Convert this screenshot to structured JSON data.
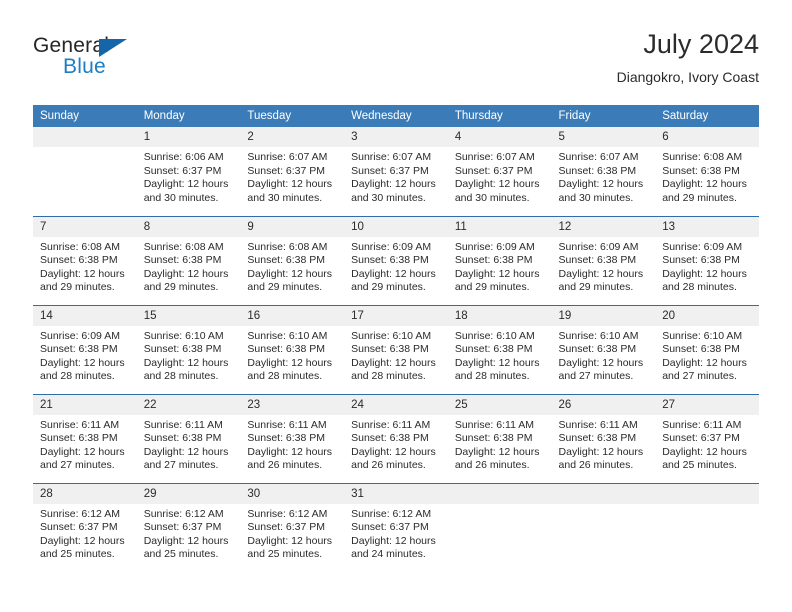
{
  "brand": {
    "word_one": "General",
    "word_two": "Blue",
    "accent_color": "#1d7ec4",
    "triangle_color": "#1565a8"
  },
  "header": {
    "title": "July 2024",
    "location": "Diangokro, Ivory Coast"
  },
  "theme": {
    "header_row_bg": "#3b7cb8",
    "header_row_text": "#ffffff",
    "daynum_bg": "#f0f0f0",
    "row_separator": "#2f6da8",
    "body_text": "#2b2b2b"
  },
  "weekday_headers": [
    "Sunday",
    "Monday",
    "Tuesday",
    "Wednesday",
    "Thursday",
    "Friday",
    "Saturday"
  ],
  "weeks": [
    [
      {
        "day": "",
        "sunrise": "",
        "sunset": "",
        "daylight_line1": "",
        "daylight_line2": ""
      },
      {
        "day": "1",
        "sunrise": "Sunrise: 6:06 AM",
        "sunset": "Sunset: 6:37 PM",
        "daylight_line1": "Daylight: 12 hours",
        "daylight_line2": "and 30 minutes."
      },
      {
        "day": "2",
        "sunrise": "Sunrise: 6:07 AM",
        "sunset": "Sunset: 6:37 PM",
        "daylight_line1": "Daylight: 12 hours",
        "daylight_line2": "and 30 minutes."
      },
      {
        "day": "3",
        "sunrise": "Sunrise: 6:07 AM",
        "sunset": "Sunset: 6:37 PM",
        "daylight_line1": "Daylight: 12 hours",
        "daylight_line2": "and 30 minutes."
      },
      {
        "day": "4",
        "sunrise": "Sunrise: 6:07 AM",
        "sunset": "Sunset: 6:37 PM",
        "daylight_line1": "Daylight: 12 hours",
        "daylight_line2": "and 30 minutes."
      },
      {
        "day": "5",
        "sunrise": "Sunrise: 6:07 AM",
        "sunset": "Sunset: 6:38 PM",
        "daylight_line1": "Daylight: 12 hours",
        "daylight_line2": "and 30 minutes."
      },
      {
        "day": "6",
        "sunrise": "Sunrise: 6:08 AM",
        "sunset": "Sunset: 6:38 PM",
        "daylight_line1": "Daylight: 12 hours",
        "daylight_line2": "and 29 minutes."
      }
    ],
    [
      {
        "day": "7",
        "sunrise": "Sunrise: 6:08 AM",
        "sunset": "Sunset: 6:38 PM",
        "daylight_line1": "Daylight: 12 hours",
        "daylight_line2": "and 29 minutes."
      },
      {
        "day": "8",
        "sunrise": "Sunrise: 6:08 AM",
        "sunset": "Sunset: 6:38 PM",
        "daylight_line1": "Daylight: 12 hours",
        "daylight_line2": "and 29 minutes."
      },
      {
        "day": "9",
        "sunrise": "Sunrise: 6:08 AM",
        "sunset": "Sunset: 6:38 PM",
        "daylight_line1": "Daylight: 12 hours",
        "daylight_line2": "and 29 minutes."
      },
      {
        "day": "10",
        "sunrise": "Sunrise: 6:09 AM",
        "sunset": "Sunset: 6:38 PM",
        "daylight_line1": "Daylight: 12 hours",
        "daylight_line2": "and 29 minutes."
      },
      {
        "day": "11",
        "sunrise": "Sunrise: 6:09 AM",
        "sunset": "Sunset: 6:38 PM",
        "daylight_line1": "Daylight: 12 hours",
        "daylight_line2": "and 29 minutes."
      },
      {
        "day": "12",
        "sunrise": "Sunrise: 6:09 AM",
        "sunset": "Sunset: 6:38 PM",
        "daylight_line1": "Daylight: 12 hours",
        "daylight_line2": "and 29 minutes."
      },
      {
        "day": "13",
        "sunrise": "Sunrise: 6:09 AM",
        "sunset": "Sunset: 6:38 PM",
        "daylight_line1": "Daylight: 12 hours",
        "daylight_line2": "and 28 minutes."
      }
    ],
    [
      {
        "day": "14",
        "sunrise": "Sunrise: 6:09 AM",
        "sunset": "Sunset: 6:38 PM",
        "daylight_line1": "Daylight: 12 hours",
        "daylight_line2": "and 28 minutes."
      },
      {
        "day": "15",
        "sunrise": "Sunrise: 6:10 AM",
        "sunset": "Sunset: 6:38 PM",
        "daylight_line1": "Daylight: 12 hours",
        "daylight_line2": "and 28 minutes."
      },
      {
        "day": "16",
        "sunrise": "Sunrise: 6:10 AM",
        "sunset": "Sunset: 6:38 PM",
        "daylight_line1": "Daylight: 12 hours",
        "daylight_line2": "and 28 minutes."
      },
      {
        "day": "17",
        "sunrise": "Sunrise: 6:10 AM",
        "sunset": "Sunset: 6:38 PM",
        "daylight_line1": "Daylight: 12 hours",
        "daylight_line2": "and 28 minutes."
      },
      {
        "day": "18",
        "sunrise": "Sunrise: 6:10 AM",
        "sunset": "Sunset: 6:38 PM",
        "daylight_line1": "Daylight: 12 hours",
        "daylight_line2": "and 28 minutes."
      },
      {
        "day": "19",
        "sunrise": "Sunrise: 6:10 AM",
        "sunset": "Sunset: 6:38 PM",
        "daylight_line1": "Daylight: 12 hours",
        "daylight_line2": "and 27 minutes."
      },
      {
        "day": "20",
        "sunrise": "Sunrise: 6:10 AM",
        "sunset": "Sunset: 6:38 PM",
        "daylight_line1": "Daylight: 12 hours",
        "daylight_line2": "and 27 minutes."
      }
    ],
    [
      {
        "day": "21",
        "sunrise": "Sunrise: 6:11 AM",
        "sunset": "Sunset: 6:38 PM",
        "daylight_line1": "Daylight: 12 hours",
        "daylight_line2": "and 27 minutes."
      },
      {
        "day": "22",
        "sunrise": "Sunrise: 6:11 AM",
        "sunset": "Sunset: 6:38 PM",
        "daylight_line1": "Daylight: 12 hours",
        "daylight_line2": "and 27 minutes."
      },
      {
        "day": "23",
        "sunrise": "Sunrise: 6:11 AM",
        "sunset": "Sunset: 6:38 PM",
        "daylight_line1": "Daylight: 12 hours",
        "daylight_line2": "and 26 minutes."
      },
      {
        "day": "24",
        "sunrise": "Sunrise: 6:11 AM",
        "sunset": "Sunset: 6:38 PM",
        "daylight_line1": "Daylight: 12 hours",
        "daylight_line2": "and 26 minutes."
      },
      {
        "day": "25",
        "sunrise": "Sunrise: 6:11 AM",
        "sunset": "Sunset: 6:38 PM",
        "daylight_line1": "Daylight: 12 hours",
        "daylight_line2": "and 26 minutes."
      },
      {
        "day": "26",
        "sunrise": "Sunrise: 6:11 AM",
        "sunset": "Sunset: 6:38 PM",
        "daylight_line1": "Daylight: 12 hours",
        "daylight_line2": "and 26 minutes."
      },
      {
        "day": "27",
        "sunrise": "Sunrise: 6:11 AM",
        "sunset": "Sunset: 6:37 PM",
        "daylight_line1": "Daylight: 12 hours",
        "daylight_line2": "and 25 minutes."
      }
    ],
    [
      {
        "day": "28",
        "sunrise": "Sunrise: 6:12 AM",
        "sunset": "Sunset: 6:37 PM",
        "daylight_line1": "Daylight: 12 hours",
        "daylight_line2": "and 25 minutes."
      },
      {
        "day": "29",
        "sunrise": "Sunrise: 6:12 AM",
        "sunset": "Sunset: 6:37 PM",
        "daylight_line1": "Daylight: 12 hours",
        "daylight_line2": "and 25 minutes."
      },
      {
        "day": "30",
        "sunrise": "Sunrise: 6:12 AM",
        "sunset": "Sunset: 6:37 PM",
        "daylight_line1": "Daylight: 12 hours",
        "daylight_line2": "and 25 minutes."
      },
      {
        "day": "31",
        "sunrise": "Sunrise: 6:12 AM",
        "sunset": "Sunset: 6:37 PM",
        "daylight_line1": "Daylight: 12 hours",
        "daylight_line2": "and 24 minutes."
      },
      {
        "day": "",
        "sunrise": "",
        "sunset": "",
        "daylight_line1": "",
        "daylight_line2": ""
      },
      {
        "day": "",
        "sunrise": "",
        "sunset": "",
        "daylight_line1": "",
        "daylight_line2": ""
      },
      {
        "day": "",
        "sunrise": "",
        "sunset": "",
        "daylight_line1": "",
        "daylight_line2": ""
      }
    ]
  ]
}
